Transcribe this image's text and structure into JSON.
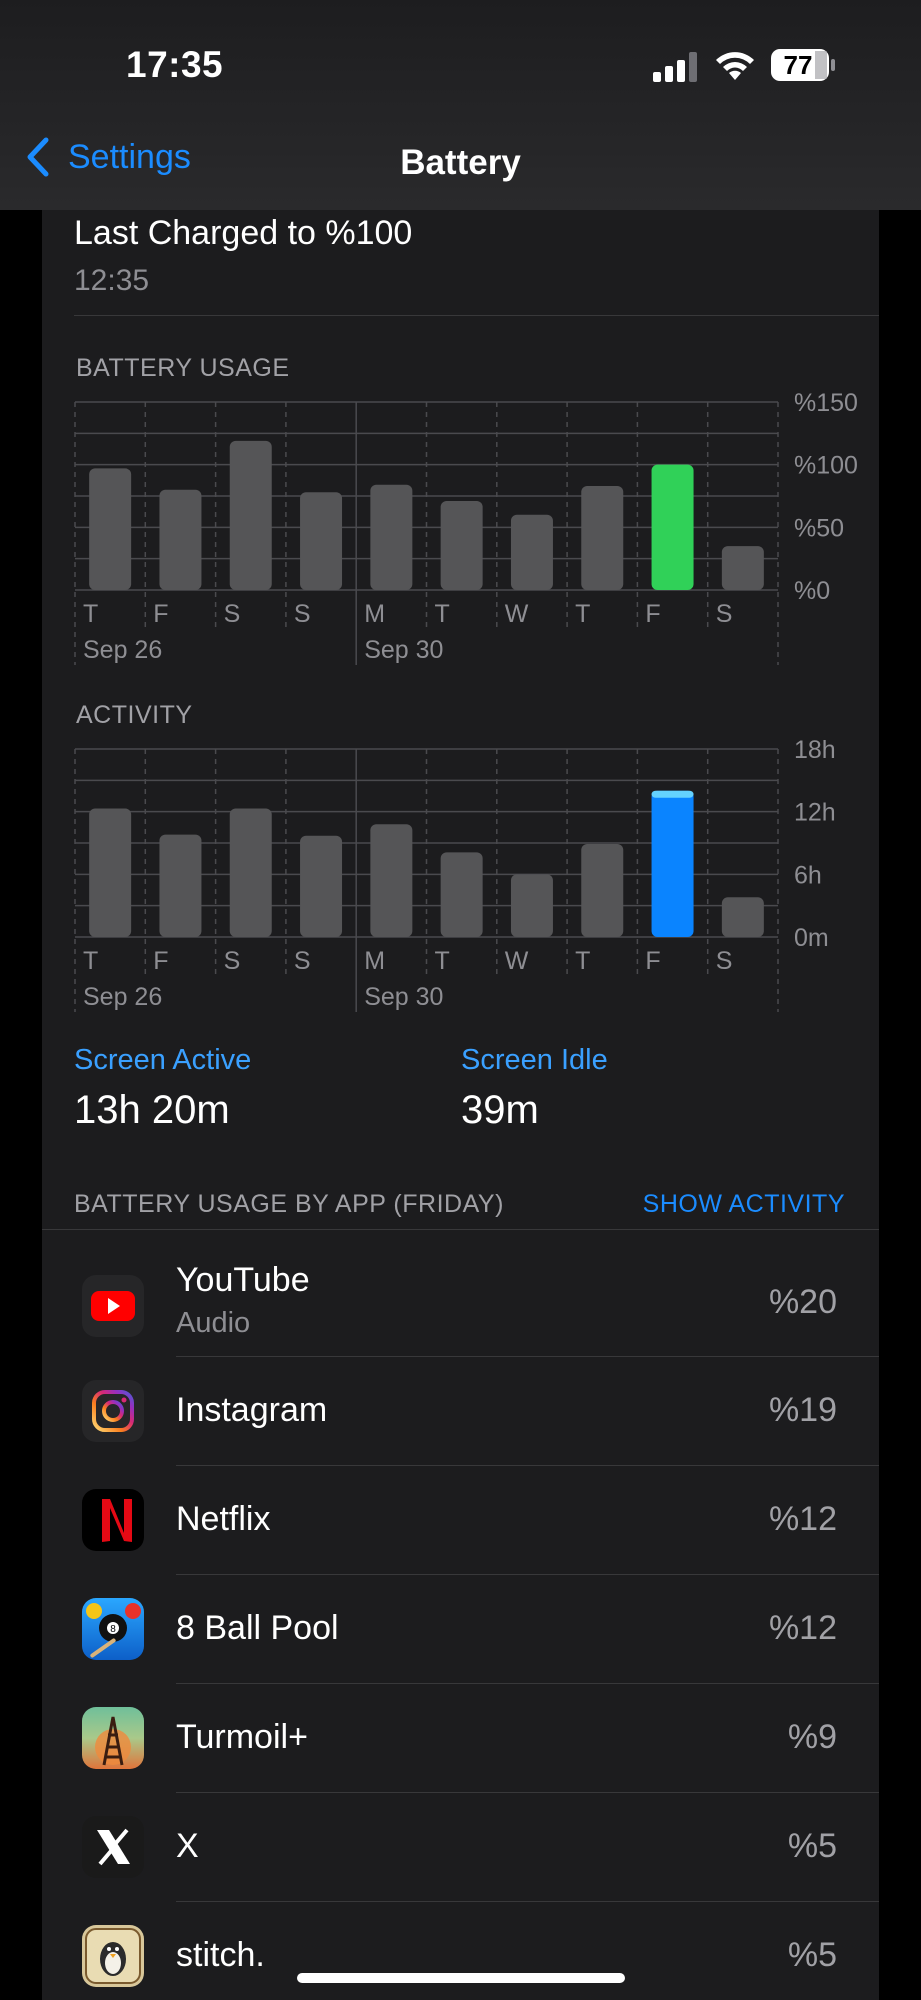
{
  "status": {
    "time": "17:35",
    "battery_level": "77"
  },
  "nav": {
    "back_label": "Settings",
    "title": "Battery"
  },
  "last_charged": {
    "title": "Last Charged to %100",
    "time": "12:35"
  },
  "battery_chart": {
    "label": "BATTERY USAGE",
    "y_ticks": [
      "%150",
      "%100",
      "%50",
      "%0"
    ],
    "day_labels": [
      "T",
      "F",
      "S",
      "S",
      "M",
      "T",
      "W",
      "T",
      "F",
      "S"
    ],
    "date_labels": [
      "Sep 26",
      "Sep 30"
    ]
  },
  "activity_chart": {
    "label": "ACTIVITY",
    "y_ticks": [
      "18h",
      "12h",
      "6h",
      "0m"
    ],
    "day_labels": [
      "T",
      "F",
      "S",
      "S",
      "M",
      "T",
      "W",
      "T",
      "F",
      "S"
    ],
    "date_labels": [
      "Sep 26",
      "Sep 30"
    ]
  },
  "chart_data": [
    {
      "type": "bar",
      "title": "BATTERY USAGE",
      "categories": [
        "T",
        "F",
        "S",
        "S",
        "M",
        "T",
        "W",
        "T",
        "F",
        "S"
      ],
      "values": [
        97,
        80,
        119,
        78,
        84,
        71,
        60,
        83,
        100,
        35
      ],
      "ylim": [
        0,
        150
      ],
      "unit": "%",
      "highlight_index": 8,
      "highlight_color": "#30d158",
      "bar_color": "#555557"
    },
    {
      "type": "bar",
      "title": "ACTIVITY",
      "categories": [
        "T",
        "F",
        "S",
        "S",
        "M",
        "T",
        "W",
        "T",
        "F",
        "S"
      ],
      "values": [
        12.3,
        9.8,
        12.3,
        9.7,
        10.8,
        8.1,
        6.0,
        8.9,
        14.0,
        3.8
      ],
      "ylim": [
        0,
        18
      ],
      "unit": "h",
      "highlight_index": 8,
      "highlight_color": "#0a84ff",
      "highlight_cap_color": "#64d2ff",
      "bar_color": "#555557"
    }
  ],
  "stats": {
    "active_label": "Screen Active",
    "active_value": "13h 20m",
    "idle_label": "Screen Idle",
    "idle_value": "39m"
  },
  "apps_section": {
    "label": "BATTERY USAGE BY APP (FRIDAY)",
    "action": "SHOW ACTIVITY"
  },
  "apps": [
    {
      "name": "YouTube",
      "sub": "Audio",
      "pct": "%20",
      "icon": "youtube-icon"
    },
    {
      "name": "Instagram",
      "pct": "%19",
      "icon": "instagram-icon"
    },
    {
      "name": "Netflix",
      "pct": "%12",
      "icon": "netflix-icon"
    },
    {
      "name": "8 Ball Pool",
      "pct": "%12",
      "icon": "8-ball-pool-icon"
    },
    {
      "name": "Turmoil+",
      "pct": "%9",
      "icon": "turmoil-icon"
    },
    {
      "name": "X",
      "pct": "%5",
      "icon": "x-icon"
    },
    {
      "name": "stitch.",
      "pct": "%5",
      "icon": "stitch-icon"
    }
  ]
}
